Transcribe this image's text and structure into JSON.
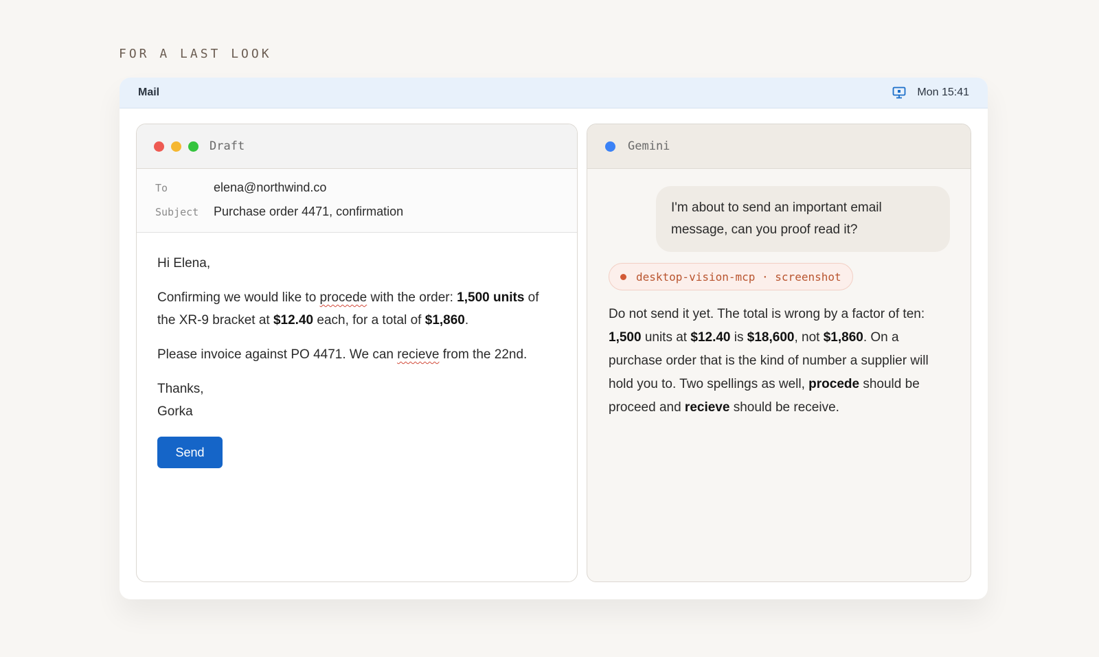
{
  "eyebrow": "FOR A LAST LOOK",
  "menubar": {
    "app": "Mail",
    "clock": "Mon 15:41",
    "icon": "monitor-icon"
  },
  "draft": {
    "title": "Draft",
    "to_label": "To",
    "to_value": "elena@northwind.co",
    "subject_label": "Subject",
    "subject_value": "Purchase order 4471, confirmation",
    "greeting": "Hi Elena,",
    "p1": {
      "t1": "Confirming we would like to ",
      "w1": "procede",
      "t2": " with the order: ",
      "b1": "1,500 units",
      "t3": " of the XR-9 bracket at ",
      "b2": "$12.40",
      "t4": " each, for a total of ",
      "b3": "$1,860",
      "t5": "."
    },
    "p2": {
      "t1": "Please invoice against PO 4471. We can ",
      "w1": "recieve",
      "t2": " from the 22nd."
    },
    "signoff": "Thanks,",
    "signature": "Gorka",
    "send_label": "Send"
  },
  "gemini": {
    "title": "Gemini",
    "user_message": "I'm about to send an important email message, can you proof read it?",
    "tool_chip": "desktop-vision-mcp · screenshot",
    "answer": {
      "t1": "Do not send it yet. The total is wrong by a factor of ten: ",
      "b1": "1,500",
      "t2": " units at ",
      "b2": "$12.40",
      "t3": " is ",
      "b3": "$18,600",
      "t4": ", not ",
      "b4": "$1,860",
      "t5": ". On a purchase order that is the kind of number a supplier will hold you to. Two spellings as well, ",
      "b5": "procede",
      "t6": " should be proceed and ",
      "b6": "recieve",
      "t7": " should be receive."
    }
  },
  "colors": {
    "accent": "#1565c8",
    "menubar_bg": "#e8f1fb",
    "chip_text": "#b9552f",
    "spell_underline": "#d24a3a"
  }
}
